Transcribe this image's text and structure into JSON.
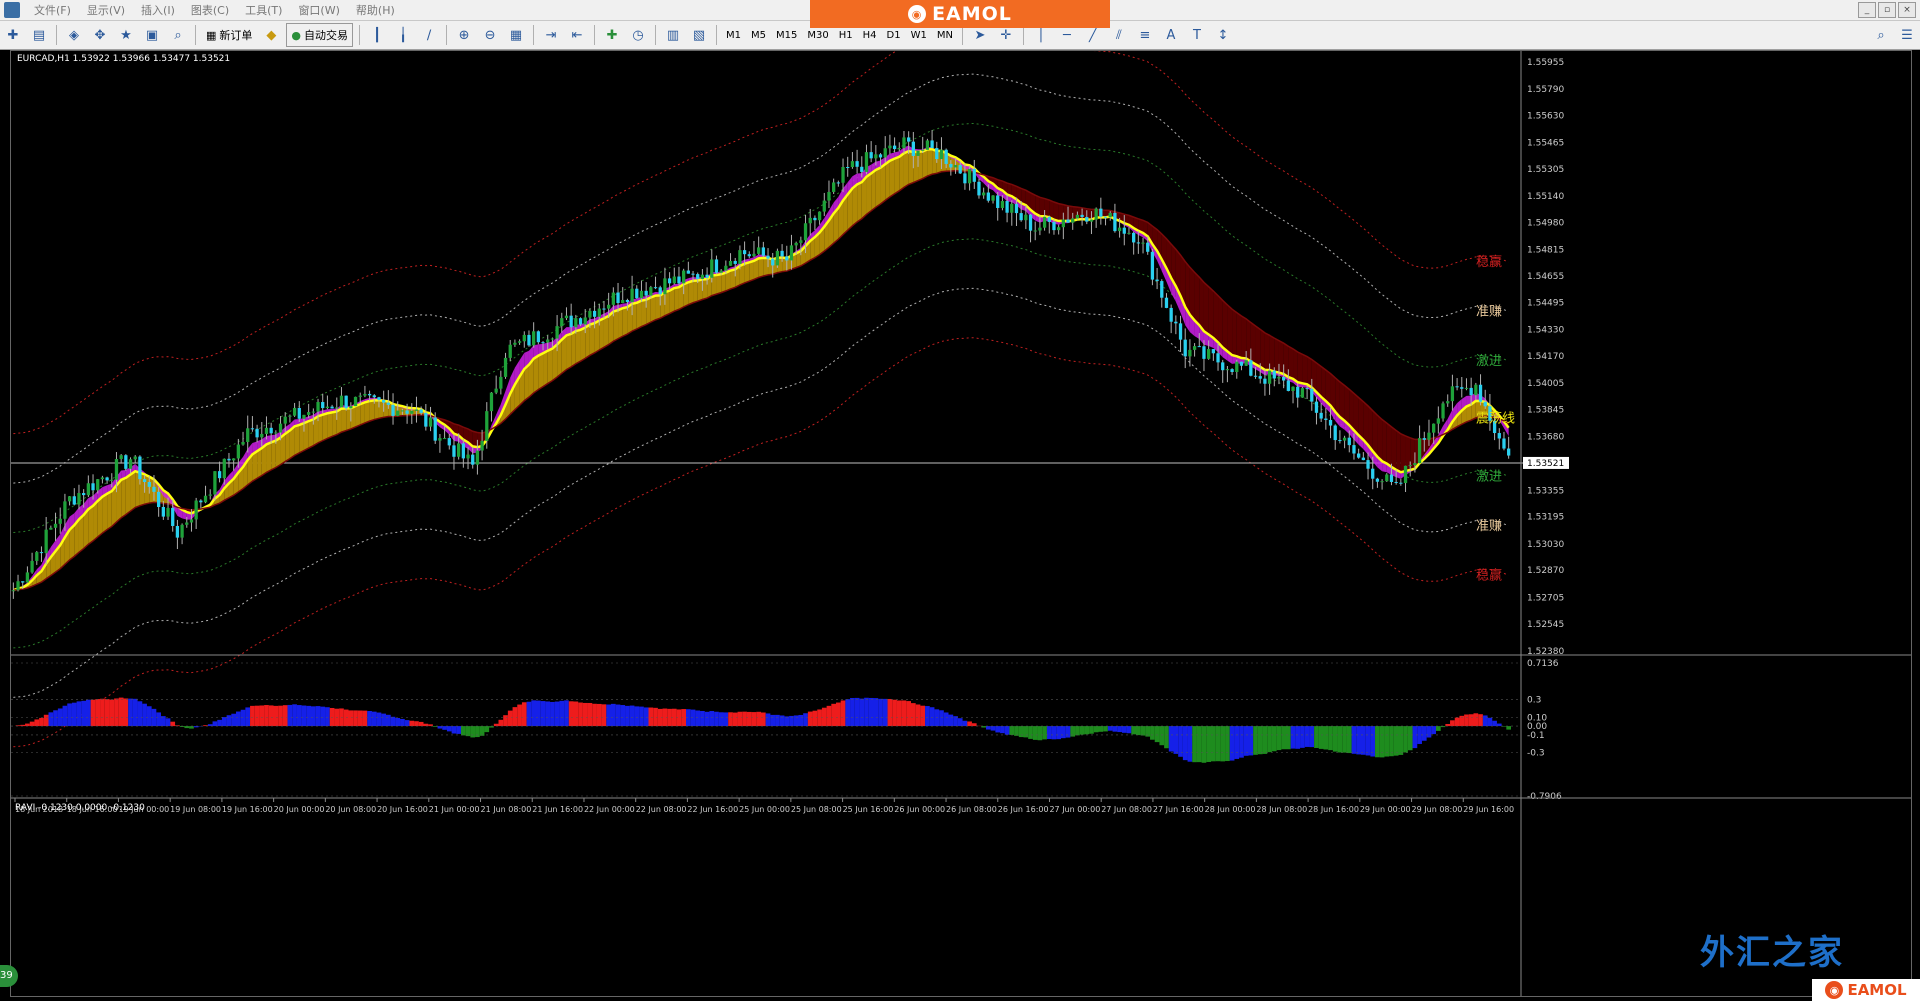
{
  "app": {
    "menu": [
      "文件(F)",
      "显示(V)",
      "插入(I)",
      "图表(C)",
      "工具(T)",
      "窗口(W)",
      "帮助(H)"
    ],
    "banner_text": "EAMOL",
    "logo_text": "EAMOL",
    "watermark": "外汇之家",
    "badge": "39"
  },
  "toolbar": {
    "new_order": "新订单",
    "auto_trade": "自动交易",
    "timeframes": [
      "M1",
      "M5",
      "M15",
      "M30",
      "H1",
      "H4",
      "D1",
      "W1",
      "MN"
    ]
  },
  "chart": {
    "header": "EURCAD,H1  1.53922 1.53966 1.53477 1.53521",
    "current_price": "1.53521",
    "price_ticks": [
      "1.55955",
      "1.55790",
      "1.55630",
      "1.55465",
      "1.55305",
      "1.55140",
      "1.54980",
      "1.54815",
      "1.54655",
      "1.54495",
      "1.54330",
      "1.54170",
      "1.54005",
      "1.53845",
      "1.53680",
      "1.53521",
      "1.53355",
      "1.53195",
      "1.53030",
      "1.52870",
      "1.52705",
      "1.52545",
      "1.52380"
    ],
    "price_range": [
      1.5238,
      1.5599
    ],
    "time_labels": [
      "18 Jun 2018",
      "18 Jun 16:00",
      "19 Jun 00:00",
      "19 Jun 08:00",
      "19 Jun 16:00",
      "20 Jun 00:00",
      "20 Jun 08:00",
      "20 Jun 16:00",
      "21 Jun 00:00",
      "21 Jun 08:00",
      "21 Jun 16:00",
      "22 Jun 00:00",
      "22 Jun 08:00",
      "22 Jun 16:00",
      "25 Jun 00:00",
      "25 Jun 08:00",
      "25 Jun 16:00",
      "26 Jun 00:00",
      "26 Jun 08:00",
      "26 Jun 16:00",
      "27 Jun 00:00",
      "27 Jun 08:00",
      "27 Jun 16:00",
      "28 Jun 00:00",
      "28 Jun 08:00",
      "28 Jun 16:00",
      "29 Jun 00:00",
      "29 Jun 08:00",
      "29 Jun 16:00"
    ],
    "band_labels": [
      {
        "text": "稳赢",
        "color": "#d02020"
      },
      {
        "text": "准赚",
        "color": "#e8c89a"
      },
      {
        "text": "激进",
        "color": "#2fa83a"
      },
      {
        "text": "震荡线",
        "color": "#e8e010"
      },
      {
        "text": "激进",
        "color": "#2fa83a"
      },
      {
        "text": "准赚",
        "color": "#e8c89a"
      },
      {
        "text": "稳赢",
        "color": "#d02020"
      }
    ],
    "colors": {
      "bull": "#1fa23a",
      "bear": "#2ad0f0",
      "wick": "#b0b0b0",
      "up_fill": "#b08a05",
      "down_fill": "#5a0000",
      "magenta": "#d020e8",
      "yellow": "#ffff10"
    }
  },
  "indicator": {
    "header": "RAVI -0.1230 0.0000 -0.1230",
    "ticks": [
      "0.7136",
      "0.3",
      "0.10",
      "0.00",
      "-0.1",
      "-0.3",
      "-0.7906"
    ],
    "range": [
      -0.7906,
      0.7136
    ],
    "colors": {
      "red": "#ee1c1c",
      "blue": "#1520e8",
      "green": "#1e8c1e"
    }
  }
}
